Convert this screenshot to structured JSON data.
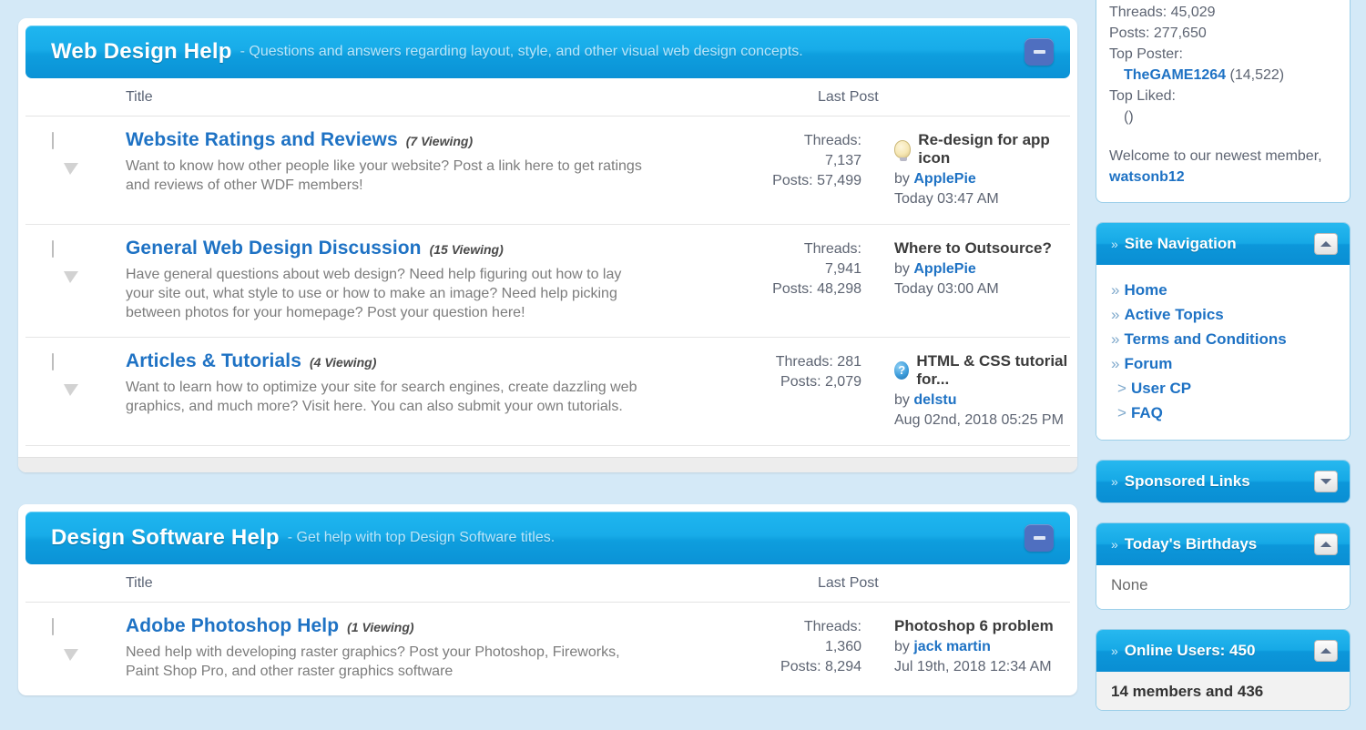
{
  "blocks": [
    {
      "title": "Web Design Help",
      "desc": "- Questions and answers regarding layout, style, and other visual web design concepts.",
      "collapse_icon": "minus-icon",
      "columns": {
        "title": "Title",
        "last_post": "Last Post"
      },
      "rows": [
        {
          "icon": "speech-bubble-icon",
          "name": "Website Ratings and Reviews",
          "viewing": "(7 Viewing)",
          "desc": "Want to know how other people like your website? Post a link here to get ratings and reviews of other WDF members!",
          "threads_label": "Threads:",
          "threads": "7,137",
          "posts": "Posts: 57,499",
          "last_icon": "lightbulb-icon",
          "last_title": "Re-design for app icon",
          "by_prefix": "by",
          "by_user": "ApplePie",
          "last_date": "Today 03:47 AM"
        },
        {
          "icon": "speech-bubble-icon",
          "name": "General Web Design Discussion",
          "viewing": "(15 Viewing)",
          "desc": "Have general questions about web design? Need help figuring out how to lay your site out, what style to use or how to make an image? Need help picking between photos for your homepage? Post your question here!",
          "threads_label": "Threads:",
          "threads": "7,941",
          "posts": "Posts: 48,298",
          "last_icon": "none",
          "last_title": "Where to Outsource?",
          "by_prefix": "by",
          "by_user": "ApplePie",
          "last_date": "Today 03:00 AM"
        },
        {
          "icon": "speech-bubble-icon",
          "name": "Articles & Tutorials",
          "viewing": "(4 Viewing)",
          "desc": "Want to learn how to optimize your site for search engines, create dazzling web graphics, and much more? Visit here. You can also submit your own tutorials.",
          "threads_label": "Threads: 281",
          "threads": "",
          "posts": "Posts: 2,079",
          "last_icon": "help-circle-icon",
          "last_title": "HTML & CSS tutorial for...",
          "by_prefix": "by",
          "by_user": "delstu",
          "last_date": "Aug 02nd, 2018 05:25 PM"
        }
      ]
    },
    {
      "title": "Design Software Help",
      "desc": "- Get help with top Design Software titles.",
      "collapse_icon": "minus-icon",
      "columns": {
        "title": "Title",
        "last_post": "Last Post"
      },
      "rows": [
        {
          "icon": "speech-bubble-icon",
          "name": "Adobe Photoshop Help",
          "viewing": "(1 Viewing)",
          "desc": "Need help with developing raster graphics? Post your Photoshop, Fireworks, Paint Shop Pro, and other raster graphics software",
          "threads_label": "Threads:",
          "threads": "1,360",
          "posts": "Posts: 8,294",
          "last_icon": "none",
          "last_title": "Photoshop 6 problem",
          "by_prefix": "by",
          "by_user": "jack martin",
          "last_date": "Jul 19th, 2018 12:34 AM"
        }
      ]
    }
  ],
  "sidebar": {
    "stats": {
      "threads": "Threads: 45,029",
      "posts": "Posts: 277,650",
      "top_poster_label": "Top Poster:",
      "top_poster_name": "TheGAME1264",
      "top_poster_count": "(14,522)",
      "top_liked_label": "Top Liked:",
      "top_liked_value": "()",
      "welcome_prefix": "Welcome to our newest member,",
      "welcome_member": "watsonb12"
    },
    "panels": [
      {
        "title": "Site Navigation",
        "bullet": "»",
        "toggle": "chevron-up-icon",
        "expanded": true,
        "items": [
          {
            "mark": "»",
            "label": "Home",
            "sub": false
          },
          {
            "mark": "»",
            "label": "Active Topics",
            "sub": false
          },
          {
            "mark": "»",
            "label": "Terms and Conditions",
            "sub": false
          },
          {
            "mark": "»",
            "label": "Forum",
            "sub": false
          },
          {
            "mark": ">",
            "label": "User CP",
            "sub": true
          },
          {
            "mark": ">",
            "label": "FAQ",
            "sub": true
          }
        ]
      },
      {
        "title": "Sponsored Links",
        "bullet": "»",
        "toggle": "chevron-down-icon",
        "expanded": false,
        "items": []
      },
      {
        "title": "Today's Birthdays",
        "bullet": "»",
        "toggle": "chevron-up-icon",
        "expanded": true,
        "body_text": "None"
      },
      {
        "title": "Online Users: 450",
        "bullet": "»",
        "toggle": "chevron-up-icon",
        "expanded": true,
        "body_text": "14 members and 436"
      }
    ]
  },
  "colors": {
    "page_bg": "#d4e9f7",
    "header_blue": "#16ace9",
    "link_blue": "#1e72c4",
    "panel_border": "#9ccfe9",
    "text_grey": "#5d6472"
  }
}
